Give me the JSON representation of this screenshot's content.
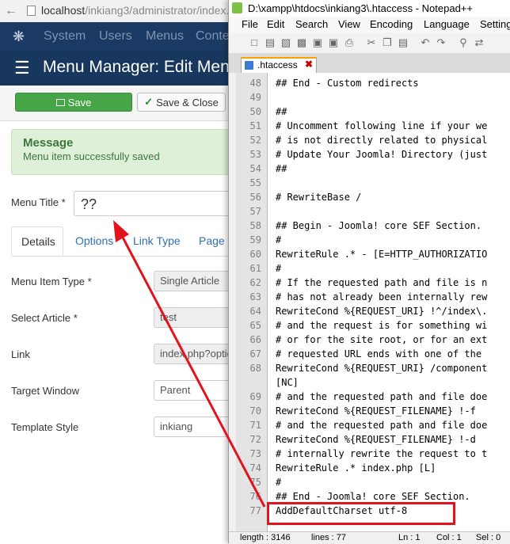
{
  "browser": {
    "url_main": "localhost",
    "url_path": "/inkiang3/administrator/index.p"
  },
  "joomla": {
    "nav": [
      "System",
      "Users",
      "Menus",
      "Conte"
    ],
    "page_title": "Menu Manager: Edit Menu",
    "toolbar": {
      "save_label": "Save",
      "save_close_label": "Save & Close"
    },
    "message": {
      "heading": "Message",
      "body": "Menu item successfully saved"
    },
    "menu_title_label": "Menu Title *",
    "menu_title_value": "??",
    "tabs": [
      "Details",
      "Options",
      "Link Type",
      "Page D"
    ],
    "fields": [
      {
        "label": "Menu Item Type *",
        "value": "Single Article"
      },
      {
        "label": "Select Article *",
        "value": "test"
      },
      {
        "label": "Link",
        "value": "index.php?optio"
      },
      {
        "label": "Target Window",
        "value": "Parent"
      },
      {
        "label": "Template Style",
        "value": "inkiang"
      }
    ]
  },
  "notepad": {
    "title": "D:\\xampp\\htdocs\\inkiang3\\.htaccess - Notepad++",
    "menu": [
      "File",
      "Edit",
      "Search",
      "View",
      "Encoding",
      "Language",
      "Settings"
    ],
    "tab_label": ".htaccess",
    "lines": [
      {
        "n": "48",
        "text": "## End - Custom redirects"
      },
      {
        "n": "49",
        "text": ""
      },
      {
        "n": "50",
        "text": "##"
      },
      {
        "n": "51",
        "text": "# Uncomment following line if your we"
      },
      {
        "n": "52",
        "text": "# is not directly related to physical"
      },
      {
        "n": "53",
        "text": "# Update Your Joomla! Directory (just"
      },
      {
        "n": "54",
        "text": "##"
      },
      {
        "n": "55",
        "text": ""
      },
      {
        "n": "56",
        "text": "# RewriteBase /"
      },
      {
        "n": "57",
        "text": ""
      },
      {
        "n": "58",
        "text": "## Begin - Joomla! core SEF Section."
      },
      {
        "n": "59",
        "text": "#"
      },
      {
        "n": "60",
        "text": "RewriteRule .* - [E=HTTP_AUTHORIZATIO"
      },
      {
        "n": "61",
        "text": "#"
      },
      {
        "n": "62",
        "text": "# If the requested path and file is n"
      },
      {
        "n": "63",
        "text": "# has not already been internally rew"
      },
      {
        "n": "64",
        "text": "RewriteCond %{REQUEST_URI} !^/index\\."
      },
      {
        "n": "65",
        "text": "# and the request is for something wi"
      },
      {
        "n": "66",
        "text": "# or for the site root, or for an ext"
      },
      {
        "n": "67",
        "text": "# requested URL ends with one of the"
      },
      {
        "n": "68",
        "text": "RewriteCond %{REQUEST_URI} /component"
      },
      {
        "n": "",
        "text": "[NC]"
      },
      {
        "n": "69",
        "text": "# and the requested path and file doe"
      },
      {
        "n": "70",
        "text": "RewriteCond %{REQUEST_FILENAME} !-f"
      },
      {
        "n": "71",
        "text": "# and the requested path and file doe"
      },
      {
        "n": "72",
        "text": "RewriteCond %{REQUEST_FILENAME} !-d"
      },
      {
        "n": "73",
        "text": "# internally rewrite the request to t"
      },
      {
        "n": "74",
        "text": "RewriteRule .* index.php [L]"
      },
      {
        "n": "75",
        "text": "#"
      },
      {
        "n": "76",
        "text": "## End - Joomla! core SEF Section."
      },
      {
        "n": "77",
        "text": "AddDefaultCharset utf-8"
      }
    ],
    "status": {
      "length": "length : 3146",
      "lines": "lines : 77",
      "ln": "Ln : 1",
      "col": "Col : 1",
      "sel": "Sel : 0"
    }
  },
  "colors": {
    "annotation_red": "#e3131d",
    "joomla_nav": "#1b3a63",
    "save_green": "#46a546"
  }
}
